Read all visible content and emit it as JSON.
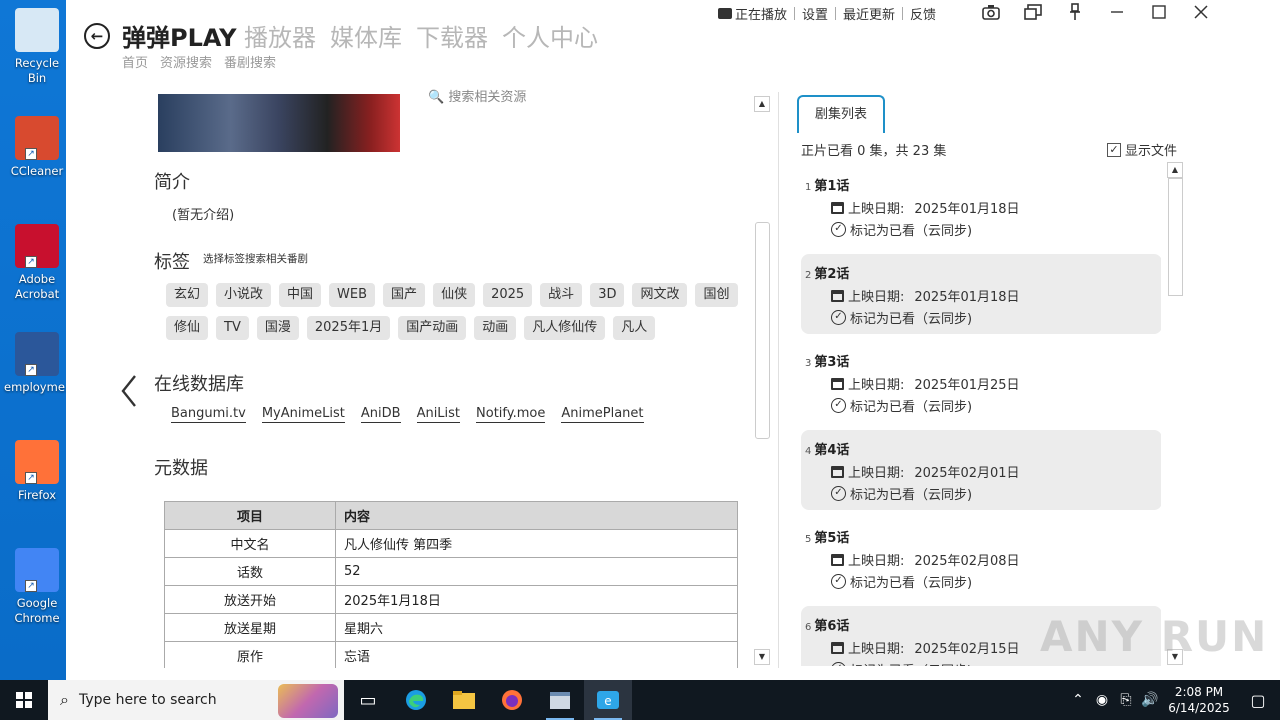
{
  "desktop": {
    "icons": [
      {
        "label": "Recycle Bin",
        "name": "recycle-bin-icon",
        "color": "#d7e8f5"
      },
      {
        "label": "CCleaner",
        "name": "ccleaner-icon",
        "color": "#d84a2f"
      },
      {
        "label": "Adobe Acrobat",
        "name": "adobe-acrobat-icon",
        "color": "#c8102e"
      },
      {
        "label": "employme...",
        "name": "word-document-icon",
        "color": "#2b579a"
      },
      {
        "label": "Firefox",
        "name": "firefox-icon",
        "color": "#ff7139"
      },
      {
        "label": "Google Chrome",
        "name": "chrome-icon",
        "color": "#4285f4"
      }
    ]
  },
  "header": {
    "brand": "弹弹PLAY",
    "main_nav": [
      "播放器",
      "媒体库",
      "下载器",
      "个人中心"
    ],
    "sub_nav": [
      "首页",
      "资源搜索",
      "番剧搜索"
    ],
    "top_links": [
      "正在播放",
      "设置",
      "最近更新",
      "反馈"
    ],
    "window_controls": [
      "camera-icon",
      "pip-icon",
      "pin-icon",
      "minimize-icon",
      "maximize-icon",
      "close-icon"
    ]
  },
  "detail": {
    "search_resources": "搜索相关资源",
    "intro_title": "简介",
    "intro_text": "(暂无介绍)",
    "tags_title": "标签",
    "tags_hint": "选择标签搜索相关番剧",
    "tags": [
      "玄幻",
      "小说改",
      "中国",
      "WEB",
      "国产",
      "仙侠",
      "2025",
      "战斗",
      "3D",
      "网文改",
      "国创",
      "修仙",
      "TV",
      "国漫",
      "2025年1月",
      "国产动画",
      "动画",
      "凡人修仙传",
      "凡人"
    ],
    "online_db_title": "在线数据库",
    "online_db_links": [
      "Bangumi.tv",
      "MyAnimeList",
      "AniDB",
      "AniList",
      "Notify.moe",
      "AnimePlanet"
    ],
    "metadata_title": "元数据",
    "metadata_headers": [
      "项目",
      "内容"
    ],
    "metadata_rows": [
      [
        "中文名",
        "凡人修仙传 第四季"
      ],
      [
        "话数",
        "52"
      ],
      [
        "放送开始",
        "2025年1月18日"
      ],
      [
        "放送星期",
        "星期六"
      ],
      [
        "原作",
        "忘语"
      ]
    ]
  },
  "episodes": {
    "tab_label": "剧集列表",
    "summary": "正片已看 0 集，共 23 集",
    "show_files_label": "显示文件",
    "show_files_checked": true,
    "air_date_label": "上映日期:",
    "mark_watched_label": "标记为已看（云同步)",
    "items": [
      {
        "num": "1",
        "title": "第1话",
        "date": "2025年01月18日"
      },
      {
        "num": "2",
        "title": "第2话",
        "date": "2025年01月18日"
      },
      {
        "num": "3",
        "title": "第3话",
        "date": "2025年01月25日"
      },
      {
        "num": "4",
        "title": "第4话",
        "date": "2025年02月01日"
      },
      {
        "num": "5",
        "title": "第5话",
        "date": "2025年02月08日"
      },
      {
        "num": "6",
        "title": "第6话",
        "date": "2025年02月15日"
      }
    ]
  },
  "watermark": "ANY RUN",
  "taskbar": {
    "search_placeholder": "Type here to search",
    "time": "2:08 PM",
    "date": "6/14/2025"
  }
}
